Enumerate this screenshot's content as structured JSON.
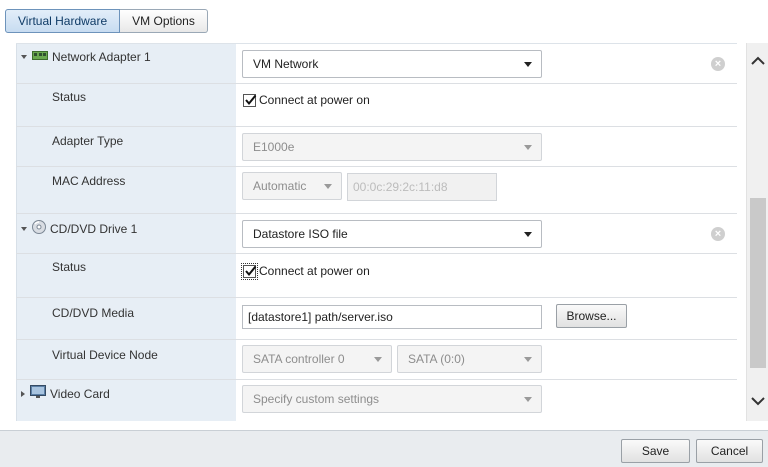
{
  "tabs": [
    {
      "label": "Virtual Hardware",
      "active": true
    },
    {
      "label": "VM Options",
      "active": false
    }
  ],
  "network_adapter": {
    "label": "Network Adapter 1",
    "network": "VM Network",
    "status_label": "Status",
    "connect_label": "Connect at power on",
    "connect_checked": true,
    "adapter_type_label": "Adapter Type",
    "adapter_type": "E1000e",
    "mac_label": "MAC Address",
    "mac_mode": "Automatic",
    "mac_value": "00:0c:29:2c:11:d8"
  },
  "cd_drive": {
    "label": "CD/DVD Drive 1",
    "source": "Datastore ISO file",
    "status_label": "Status",
    "connect_label": "Connect at power on",
    "connect_checked": true,
    "media_label": "CD/DVD Media",
    "media_path": "[datastore1] path/server.iso",
    "browse_label": "Browse...",
    "node_label": "Virtual Device Node",
    "controller": "SATA controller 0",
    "node": "SATA (0:0)"
  },
  "video_card": {
    "label": "Video Card",
    "setting": "Specify custom settings"
  },
  "footer": {
    "save_label": "Save",
    "cancel_label": "Cancel"
  },
  "colors": {
    "label_column": "#e7eef5",
    "active_tab": "#c7dcf1",
    "footer": "#e9ecef"
  }
}
